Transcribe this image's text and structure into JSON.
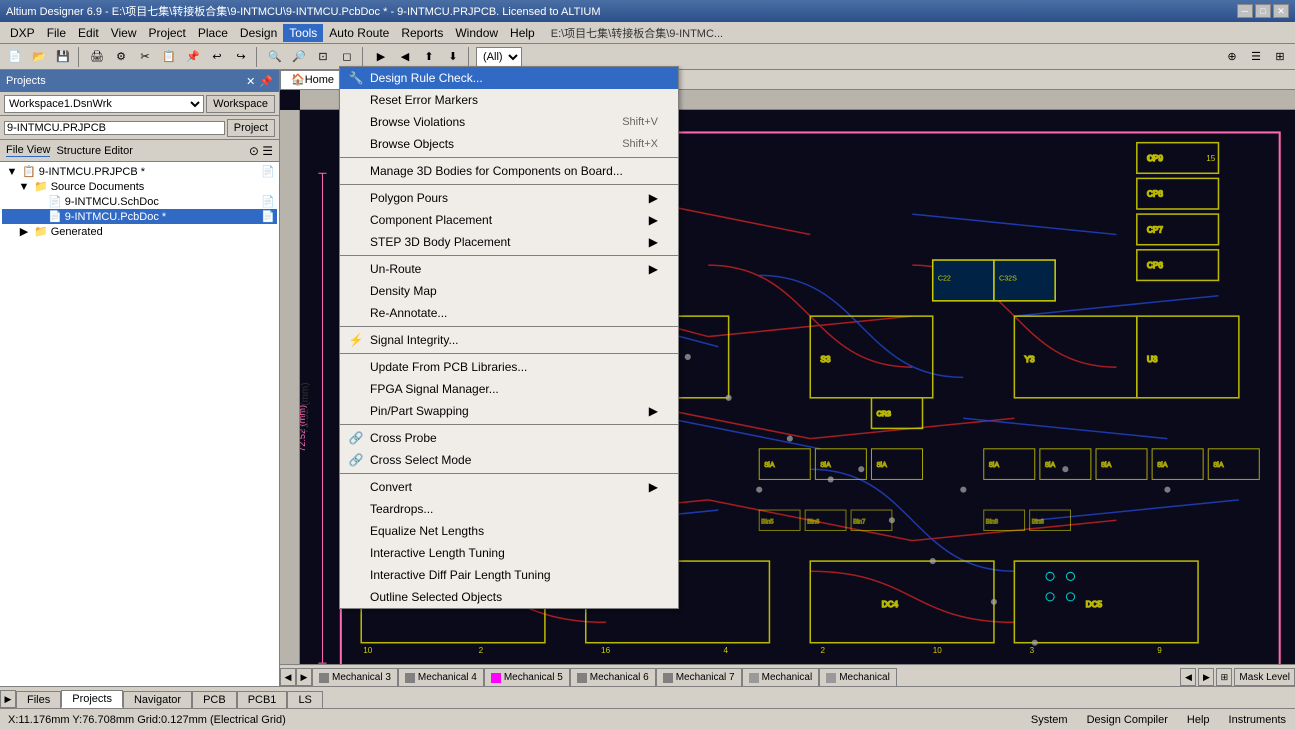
{
  "titlebar": {
    "title": "Altium Designer 6.9 - E:\\项目七集\\转接板合集\\9-INTMCU\\9-INTMCU.PcbDoc * - 9-INTMCU.PRJPCB. Licensed to ALTIUM",
    "minimize": "─",
    "maximize": "□",
    "close": "✕"
  },
  "menubar": {
    "items": [
      "DXP",
      "File",
      "Edit",
      "View",
      "Project",
      "Place",
      "Design",
      "Tools",
      "Auto Route",
      "Reports",
      "Window",
      "Help"
    ]
  },
  "tools_menu": {
    "items": [
      {
        "id": "design-rule-check",
        "label": "Design Rule Check...",
        "shortcut": "",
        "has_icon": true,
        "submenu": false,
        "highlighted": true,
        "disabled": false
      },
      {
        "id": "reset-error-markers",
        "label": "Reset Error Markers",
        "shortcut": "",
        "has_icon": false,
        "submenu": false,
        "highlighted": false,
        "disabled": false
      },
      {
        "id": "browse-violations",
        "label": "Browse Violations",
        "shortcut": "Shift+V",
        "has_icon": false,
        "submenu": false,
        "highlighted": false,
        "disabled": false
      },
      {
        "id": "browse-objects",
        "label": "Browse Objects",
        "shortcut": "Shift+X",
        "has_icon": false,
        "submenu": false,
        "highlighted": false,
        "disabled": false
      },
      {
        "id": "sep1",
        "type": "divider"
      },
      {
        "id": "manage-3d",
        "label": "Manage 3D Bodies for Components on Board...",
        "shortcut": "",
        "has_icon": false,
        "submenu": false,
        "highlighted": false,
        "disabled": false
      },
      {
        "id": "sep2",
        "type": "divider"
      },
      {
        "id": "polygon-pours",
        "label": "Polygon Pours",
        "shortcut": "",
        "has_icon": false,
        "submenu": true,
        "highlighted": false,
        "disabled": false
      },
      {
        "id": "component-placement",
        "label": "Component Placement",
        "shortcut": "",
        "has_icon": false,
        "submenu": true,
        "highlighted": false,
        "disabled": false
      },
      {
        "id": "step-3d-body",
        "label": "STEP 3D Body Placement",
        "shortcut": "",
        "has_icon": false,
        "submenu": true,
        "highlighted": false,
        "disabled": false
      },
      {
        "id": "sep3",
        "type": "divider"
      },
      {
        "id": "un-route",
        "label": "Un-Route",
        "shortcut": "",
        "has_icon": false,
        "submenu": true,
        "highlighted": false,
        "disabled": false
      },
      {
        "id": "density-map",
        "label": "Density Map",
        "shortcut": "",
        "has_icon": false,
        "submenu": false,
        "highlighted": false,
        "disabled": false
      },
      {
        "id": "re-annotate",
        "label": "Re-Annotate...",
        "shortcut": "",
        "has_icon": false,
        "submenu": false,
        "highlighted": false,
        "disabled": false
      },
      {
        "id": "sep4",
        "type": "divider"
      },
      {
        "id": "signal-integrity",
        "label": "Signal Integrity...",
        "shortcut": "",
        "has_icon": true,
        "submenu": false,
        "highlighted": false,
        "disabled": false
      },
      {
        "id": "sep5",
        "type": "divider"
      },
      {
        "id": "update-from-pcb",
        "label": "Update From PCB Libraries...",
        "shortcut": "",
        "has_icon": false,
        "submenu": false,
        "highlighted": false,
        "disabled": false
      },
      {
        "id": "fpga-signal",
        "label": "FPGA Signal Manager...",
        "shortcut": "",
        "has_icon": false,
        "submenu": false,
        "highlighted": false,
        "disabled": false
      },
      {
        "id": "pin-part-swap",
        "label": "Pin/Part Swapping",
        "shortcut": "",
        "has_icon": false,
        "submenu": true,
        "highlighted": false,
        "disabled": false
      },
      {
        "id": "sep6",
        "type": "divider"
      },
      {
        "id": "cross-probe",
        "label": "Cross Probe",
        "shortcut": "",
        "has_icon": true,
        "submenu": false,
        "highlighted": false,
        "disabled": false
      },
      {
        "id": "cross-select",
        "label": "Cross Select Mode",
        "shortcut": "",
        "has_icon": true,
        "submenu": false,
        "highlighted": false,
        "disabled": false
      },
      {
        "id": "sep7",
        "type": "divider"
      },
      {
        "id": "convert",
        "label": "Convert",
        "shortcut": "",
        "has_icon": false,
        "submenu": true,
        "highlighted": false,
        "disabled": false
      },
      {
        "id": "teardrops",
        "label": "Teardrops...",
        "shortcut": "",
        "has_icon": false,
        "submenu": false,
        "highlighted": false,
        "disabled": false
      },
      {
        "id": "equalize-net",
        "label": "Equalize Net Lengths",
        "shortcut": "",
        "has_icon": false,
        "submenu": false,
        "highlighted": false,
        "disabled": false
      },
      {
        "id": "interactive-length",
        "label": "Interactive Length Tuning",
        "shortcut": "",
        "has_icon": false,
        "submenu": false,
        "highlighted": false,
        "disabled": false
      },
      {
        "id": "interactive-diff",
        "label": "Interactive Diff Pair Length Tuning",
        "shortcut": "",
        "has_icon": false,
        "submenu": false,
        "highlighted": false,
        "disabled": false
      },
      {
        "id": "outline-selected",
        "label": "Outline Selected Objects",
        "shortcut": "",
        "has_icon": false,
        "submenu": false,
        "highlighted": false,
        "disabled": false
      }
    ]
  },
  "left_panel": {
    "title": "Projects",
    "workspace_label": "Workspace",
    "project_label": "Project",
    "workspace_value": "Workspace1.DsnWrk",
    "project_value": "9-INTMCU.PRJPCB",
    "file_view": "File View",
    "structure_editor": "Structure Editor",
    "tree": {
      "items": [
        {
          "id": "prjpcb",
          "label": "9-INTMCU.PRJPCB *",
          "level": 0,
          "expanded": true,
          "has_icon": true,
          "selected": false
        },
        {
          "id": "source-docs",
          "label": "Source Documents",
          "level": 1,
          "expanded": true,
          "has_icon": true,
          "selected": false
        },
        {
          "id": "schDoc",
          "label": "9-INTMCU.SchDoc",
          "level": 2,
          "expanded": false,
          "has_icon": true,
          "selected": false
        },
        {
          "id": "pcbDoc",
          "label": "9-INTMCU.PcbDoc *",
          "level": 2,
          "expanded": false,
          "has_icon": true,
          "selected": true
        },
        {
          "id": "generated",
          "label": "Generated",
          "level": 1,
          "expanded": false,
          "has_icon": true,
          "selected": false
        }
      ]
    }
  },
  "canvas": {
    "tab_label": "Home",
    "breadcrumb": "E:\\项目七集\\转接板合集\\9-INTMC..."
  },
  "layer_tabs": [
    {
      "id": "mechanical3",
      "label": "Mechanical 3",
      "color": "#808080"
    },
    {
      "id": "mechanical4",
      "label": "Mechanical 4",
      "color": "#808080"
    },
    {
      "id": "mechanical5",
      "label": "Mechanical 5",
      "color": "#ff00ff"
    },
    {
      "id": "mechanical6",
      "label": "Mechanical 6",
      "color": "#808080"
    },
    {
      "id": "mechanical7",
      "label": "Mechanical 7",
      "color": "#808080"
    },
    {
      "id": "mechanical-active1",
      "label": "Mechanical",
      "color": "#808080"
    },
    {
      "id": "mechanical-active2",
      "label": "Mechanical",
      "color": "#808080"
    }
  ],
  "bottom_tabs": [
    {
      "id": "files",
      "label": "Files"
    },
    {
      "id": "projects",
      "label": "Projects",
      "active": true
    },
    {
      "id": "navigator",
      "label": "Navigator"
    },
    {
      "id": "pcb",
      "label": "PCB"
    },
    {
      "id": "pcb1",
      "label": "PCB1"
    },
    {
      "id": "ls",
      "label": "LS"
    }
  ],
  "status_bar": {
    "coordinates": "X:11.176mm Y:76.708mm  Grid:0.127mm  (Electrical Grid)",
    "system": "System",
    "design_compiler": "Design Compiler",
    "help": "Help",
    "instruments": "Instruments",
    "mask_level": "Mask Level"
  },
  "toolbar_file_path": "E:\\项目七集\\转接板合集\\9-INTMC...",
  "autoroute_label": "Auto Route",
  "all_dropdown": "(All)"
}
